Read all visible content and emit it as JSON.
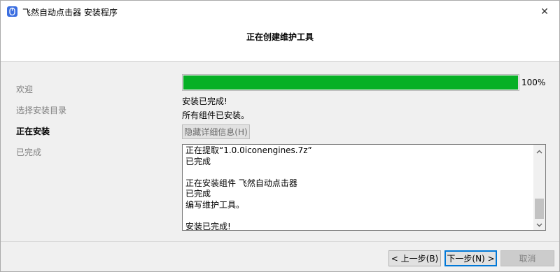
{
  "window": {
    "title": "飞然自动点击器 安装程序",
    "close_glyph": "✕"
  },
  "header": {
    "title": "正在创建维护工具"
  },
  "sidebar": {
    "items": [
      {
        "label": "欢迎",
        "state": "done"
      },
      {
        "label": "选择安装目录",
        "state": "done"
      },
      {
        "label": "正在安装",
        "state": "active"
      },
      {
        "label": "已完成",
        "state": "pending"
      }
    ]
  },
  "progress": {
    "value": 100,
    "label": "100%",
    "color": "#06b025"
  },
  "status": {
    "line1": "安装已完成!",
    "line2": "所有组件已安装。"
  },
  "details_button": {
    "label": "隐藏详细信息(H)"
  },
  "log": {
    "lines": [
      "正在提取“1.0.0iconengines.7z”",
      "已完成",
      "",
      "正在安装组件 飞然自动点击器",
      "已完成",
      "编写维护工具。",
      "",
      "安装已完成!"
    ]
  },
  "footer": {
    "back_label": "< 上一步(B)",
    "next_label": "下一步(N) >",
    "cancel_label": "取消"
  },
  "icons": {
    "app": "mouse-icon",
    "close": "close-icon",
    "scroll_up": "chevron-up-icon",
    "scroll_down": "chevron-down-icon"
  },
  "colors": {
    "accent": "#0078d7",
    "progress": "#06b025"
  }
}
